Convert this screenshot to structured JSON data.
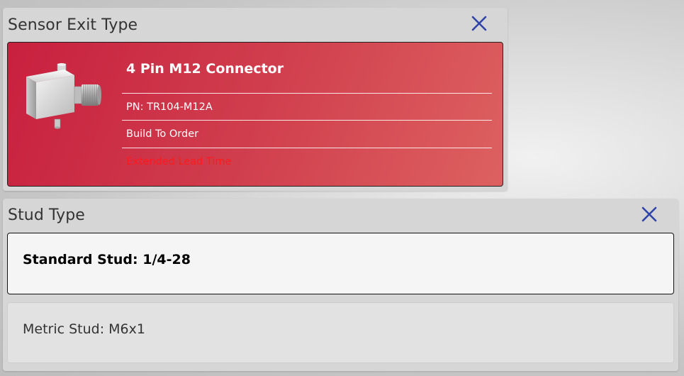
{
  "sensor_exit_panel": {
    "title": "Sensor Exit Type",
    "close_icon": "close-icon",
    "selected_option": {
      "name": "4 Pin M12 Connector",
      "part_number": "PN: TR104-M12A",
      "availability": "Build To Order",
      "lead_time_note": "Extended Lead Time",
      "lead_time_color": "#ff1a1a",
      "image": "connector-image"
    },
    "card_color": "#c8203f"
  },
  "stud_type_panel": {
    "title": "Stud Type",
    "close_icon": "close-icon",
    "options": [
      {
        "label": "Standard Stud: 1/4-28",
        "selected": true
      },
      {
        "label": "Metric Stud: M6x1",
        "selected": false
      }
    ]
  },
  "colors": {
    "close_icon": "#2f44a8",
    "panel_background": "#d6d6d6"
  }
}
